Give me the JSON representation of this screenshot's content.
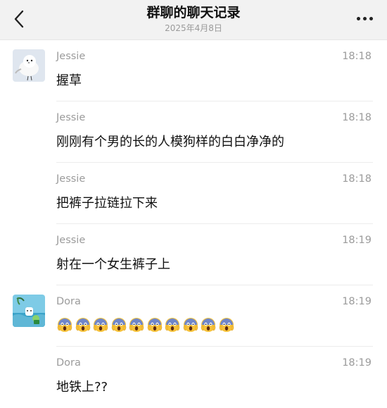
{
  "header": {
    "title": "群聊的聊天记录",
    "subtitle": "2025年4月8日",
    "back_icon": "chevron-left-icon",
    "more_icon": "ellipsis-icon"
  },
  "messages": [
    {
      "sender": "Jessie",
      "time": "18:18",
      "text": "握草",
      "avatar": "bird-avatar"
    },
    {
      "sender": "Jessie",
      "time": "18:18",
      "text": "刚刚有个男的长的人模狗样的白白净净的"
    },
    {
      "sender": "Jessie",
      "time": "18:18",
      "text": "把裤子拉链拉下来"
    },
    {
      "sender": "Jessie",
      "time": "18:19",
      "text": "射在一个女生裤子上"
    },
    {
      "sender": "Dora",
      "time": "18:19",
      "text": "",
      "avatar": "beach-avatar",
      "emoji": "scream-face-icon",
      "emoji_count": 10
    },
    {
      "sender": "Dora",
      "time": "18:19",
      "text": "地铁上??"
    }
  ],
  "colors": {
    "header_bg": "#f2f2f2",
    "meta_text": "#9b9b9b",
    "divider": "#ececec"
  }
}
